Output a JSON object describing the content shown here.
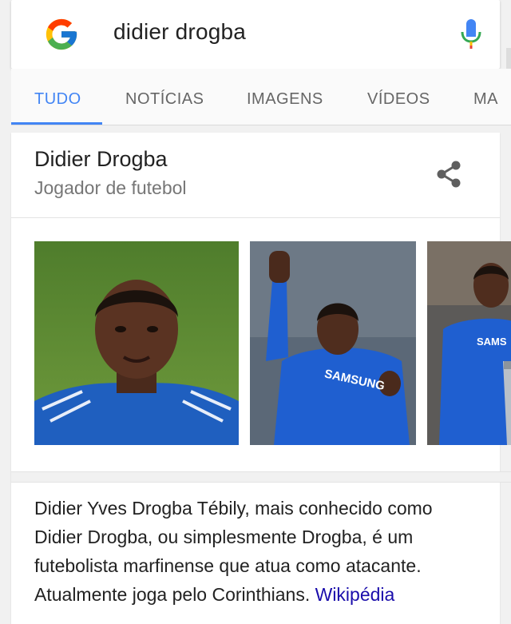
{
  "search": {
    "query": "didier drogba",
    "logo_icon": "google-g-logo",
    "mic_icon": "microphone-icon"
  },
  "tabs": [
    {
      "label": "TUDO",
      "active": true
    },
    {
      "label": "NOTÍCIAS",
      "active": false
    },
    {
      "label": "IMAGENS",
      "active": false
    },
    {
      "label": "VÍDEOS",
      "active": false
    },
    {
      "label": "MA",
      "active": false
    }
  ],
  "knowledge_panel": {
    "title": "Didier Drogba",
    "subtitle": "Jogador de futebol",
    "share_icon": "share-icon",
    "images": [
      {
        "name": "portrait-photo"
      },
      {
        "name": "celebration-photo",
        "shirt_text": "SAMSUNG"
      },
      {
        "name": "trophy-photo",
        "shirt_text": "SAMS"
      }
    ],
    "description": "Didier Yves Drogba Tébily, mais conhecido como Didier Drogba, ou simplesmente Drogba, é um futebolista marfinense que atua como atacante. Atualmente joga pelo Corinthians.",
    "source_link": "Wikipédia"
  },
  "colors": {
    "accent": "#4285f4",
    "link": "#1a0dab",
    "background": "#f1f1f1"
  }
}
